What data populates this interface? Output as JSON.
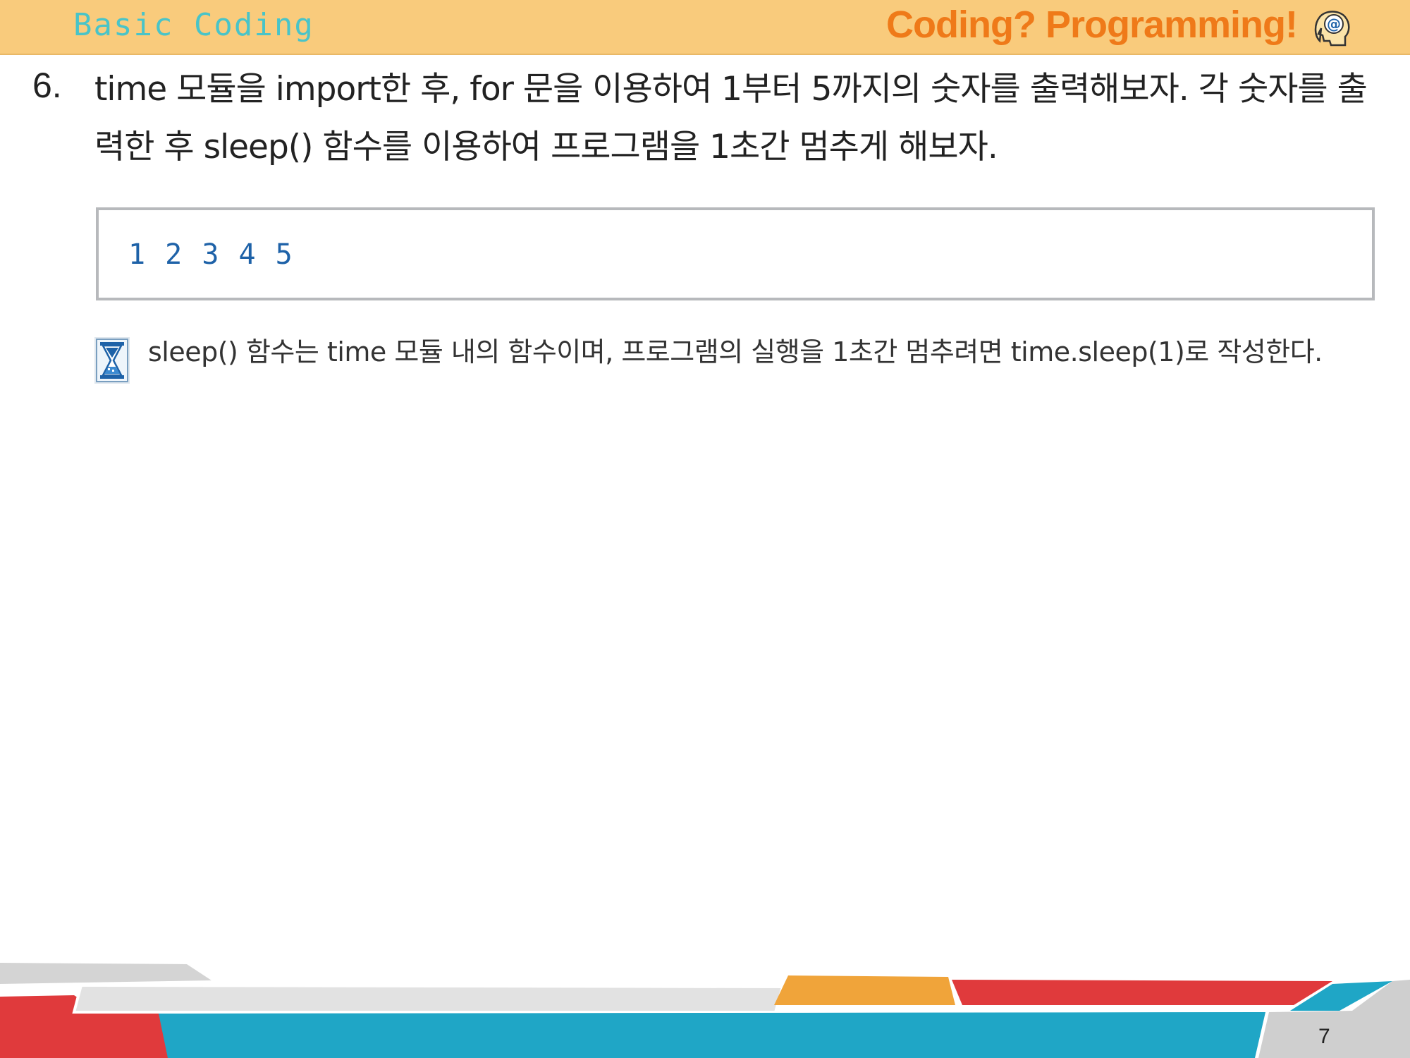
{
  "header": {
    "left_title": "Basic Coding",
    "right_title": "Coding? Programming!",
    "icon": "head-at-icon"
  },
  "question": {
    "number": "6.",
    "text": "time 모듈을 import한 후, for 문을 이용하여 1부터 5까지의 숫자를 출력해보자. 각 숫자를 출력한 후 sleep() 함수를 이용하여 프로그램을 1초간 멈추게 해보자."
  },
  "output": {
    "text": "1 2 3 4 5"
  },
  "hint": {
    "icon": "hourglass-icon",
    "text": "sleep() 함수는 time 모듈 내의 함수이며, 프로그램의 실행을 1초간 멈추려면 time.sleep(1)로 작성한다."
  },
  "footer": {
    "page_number": "7"
  },
  "colors": {
    "header_bg": "#f9cb7c",
    "header_left": "#49c4c8",
    "header_right": "#ef7a19",
    "output_text": "#1e62a8",
    "footer_red": "#e03a3c",
    "footer_teal": "#1fa6c6",
    "footer_orange": "#f0a43a",
    "footer_gray": "#cfcfcf"
  }
}
